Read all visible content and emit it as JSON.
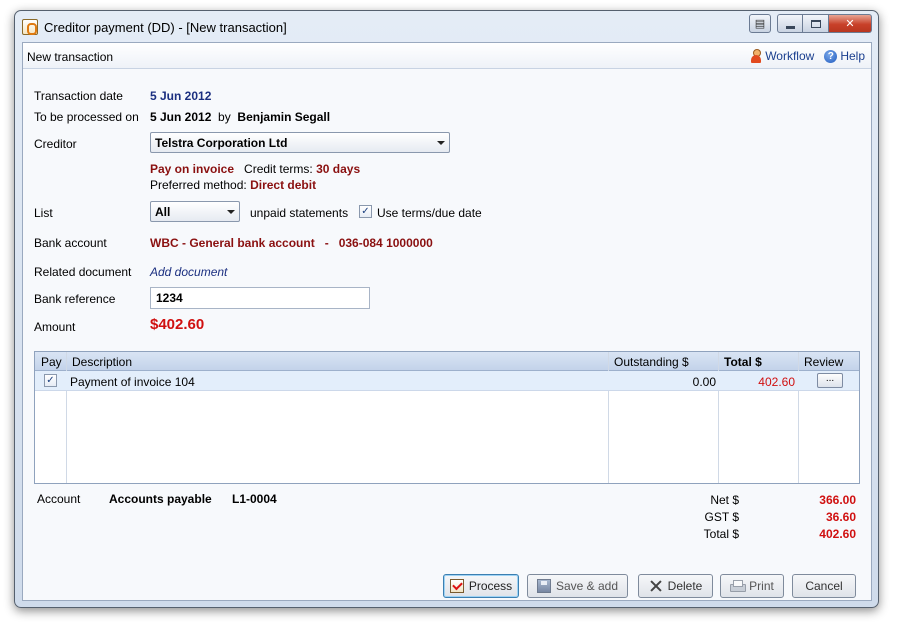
{
  "window": {
    "title": "Creditor payment (DD) - [New transaction]"
  },
  "tasks": {
    "title": "New transaction",
    "workflow_label": "Workflow",
    "help_label": "Help"
  },
  "form": {
    "transaction_date_label": "Transaction date",
    "transaction_date": "5 Jun 2012",
    "processed_label": "To be processed on",
    "processed_date": "5 Jun 2012",
    "by_label": "by",
    "processed_by": "Benjamin Segall",
    "creditor_label": "Creditor",
    "creditor_value": "Telstra Corporation Ltd",
    "pay_on_invoice": "Pay on invoice",
    "credit_terms_label": "Credit terms:",
    "credit_terms_value": "30 days",
    "preferred_method_label": "Preferred method:",
    "preferred_method_value": "Direct debit",
    "list_label": "List",
    "list_value": "All",
    "unpaid_statements": "unpaid statements",
    "use_terms_label": "Use terms/due date",
    "use_terms_checked": true,
    "bank_account_label": "Bank account",
    "bank_account_value": "WBC - General bank account   -   036-084 1000000",
    "related_document_label": "Related document",
    "add_document_link": "Add document",
    "bank_reference_label": "Bank reference",
    "bank_reference_value": "1234",
    "amount_label": "Amount",
    "amount_value": "$402.60"
  },
  "grid": {
    "columns": [
      "Pay",
      "Description",
      "Outstanding $",
      "Total $",
      "Review"
    ],
    "rows": [
      {
        "pay": true,
        "description": "Payment of invoice 104",
        "outstanding": "0.00",
        "total": "402.60",
        "review_label": "..."
      }
    ]
  },
  "footer": {
    "account_label": "Account",
    "account_name": "Accounts payable",
    "account_code": "L1-0004",
    "net_label": "Net $",
    "net_value": "366.00",
    "gst_label": "GST $",
    "gst_value": "36.60",
    "total_label": "Total $",
    "total_value": "402.60"
  },
  "buttons": {
    "process": "Process",
    "save_add": "Save & add",
    "delete": "Delete",
    "print": "Print",
    "cancel": "Cancel"
  },
  "colors": {
    "accent_navy": "#1b2f80",
    "accent_maroon": "#8a1010",
    "amount_red": "#d01010"
  }
}
